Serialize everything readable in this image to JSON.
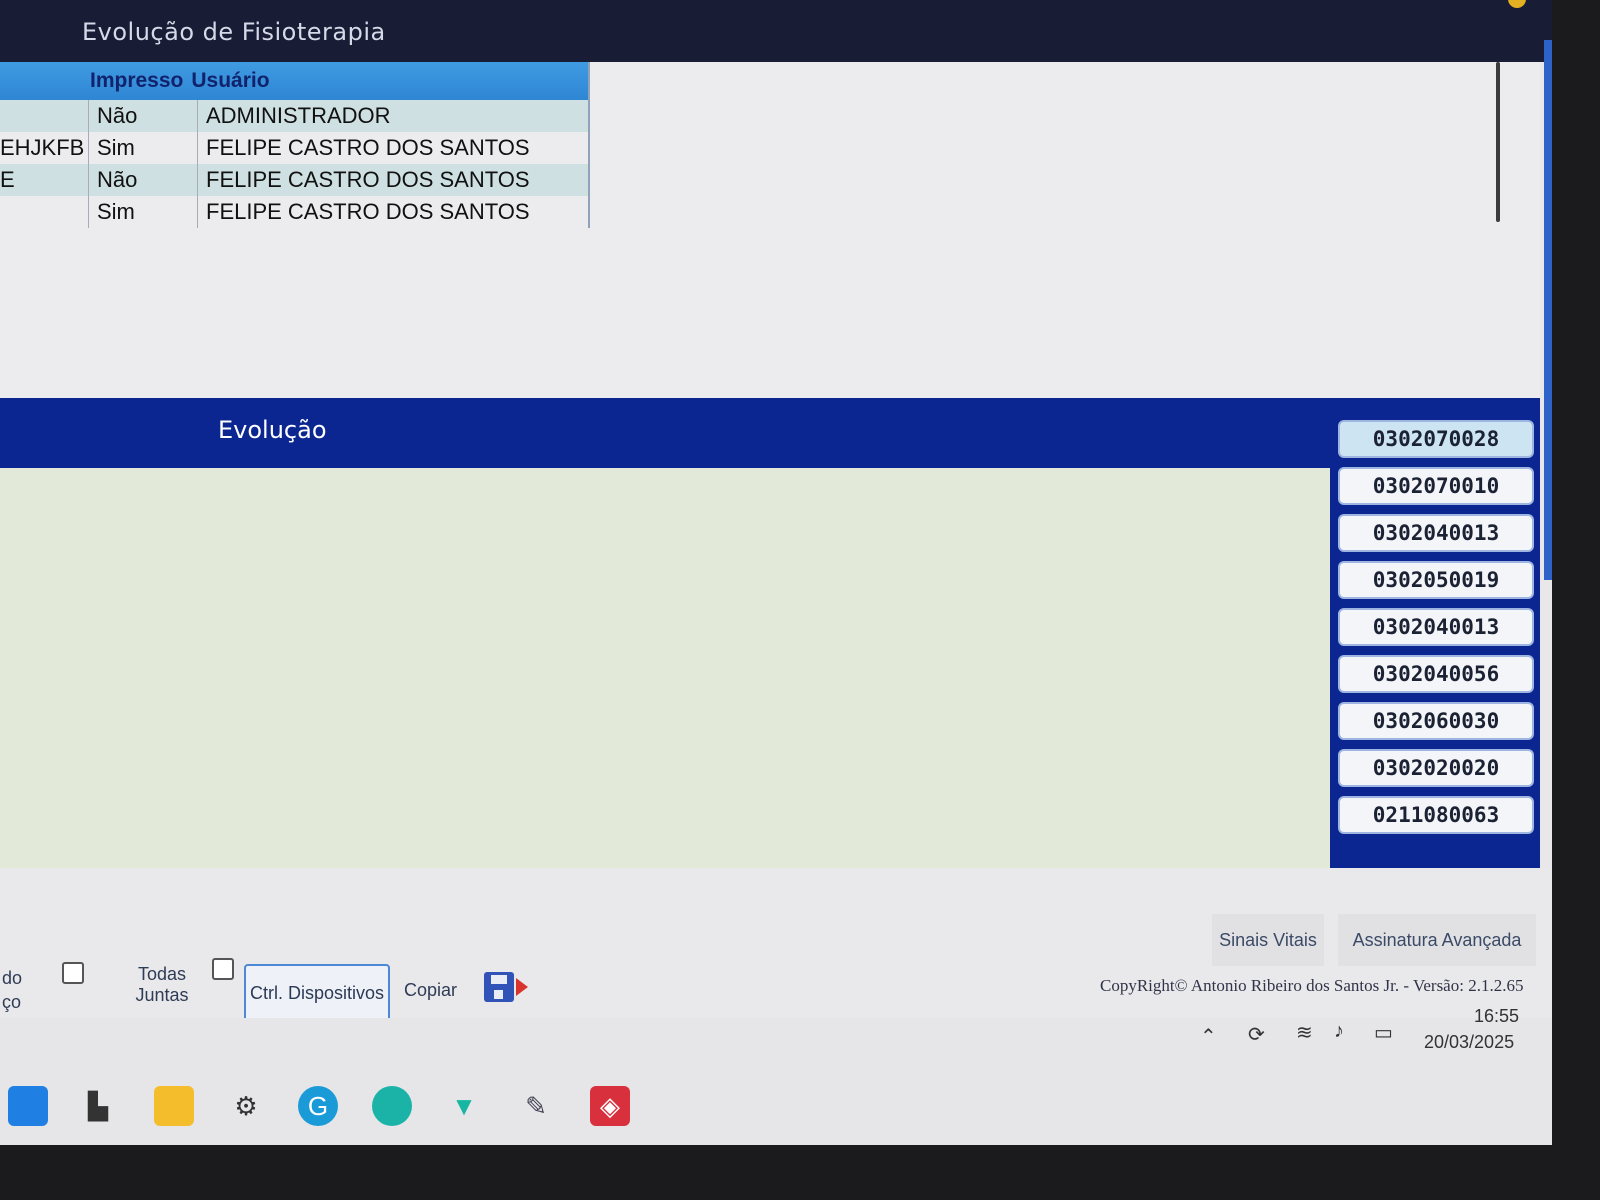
{
  "window": {
    "title": "Evolução de Fisioterapia"
  },
  "grid": {
    "headers": [
      "Impresso",
      "Usuário"
    ],
    "rows": [
      {
        "c1": "",
        "impresso": "Não",
        "usuario": "ADMINISTRADOR"
      },
      {
        "c1": "EHJKFB",
        "impresso": "Sim",
        "usuario": "FELIPE CASTRO DOS SANTOS"
      },
      {
        "c1": "E",
        "impresso": "Não",
        "usuario": "FELIPE CASTRO DOS SANTOS"
      },
      {
        "c1": "",
        "impresso": "Sim",
        "usuario": "FELIPE CASTRO DOS SANTOS"
      }
    ]
  },
  "evolucao": {
    "label": "Evolução"
  },
  "procedures": [
    "0302070028",
    "0302070010",
    "0302040013",
    "0302050019",
    "0302040013",
    "0302040056",
    "0302060030",
    "0302020020",
    "0211080063"
  ],
  "tabs": {
    "sinais": "Sinais Vitais",
    "assinatura": "Assinatura Avançada"
  },
  "toolbar": {
    "partial_label_1": "do",
    "partial_label_2": "ço",
    "todas_line1": "Todas",
    "todas_line2": "Juntas",
    "ctrl": "Ctrl. Dispositivos",
    "copiar": "Copiar"
  },
  "copyright": "CopyRight© Antonio Ribeiro dos Santos Jr. - Versão: 2.1.2.65",
  "tray": {
    "time": "16:55",
    "date": "20/03/2025"
  },
  "colors": {
    "title_bar": "#181c34",
    "evo_band": "#0b2691",
    "grid_header": "#3a93de",
    "row_alt": "#cfe0e2"
  },
  "taskbar_icons": [
    "windows-start-icon",
    "widget-icon",
    "file-explorer-icon",
    "settings-icon",
    "search-app-icon",
    "edge-icon",
    "vpn-shield-icon",
    "syringe-app-icon",
    "anydesk-icon"
  ]
}
